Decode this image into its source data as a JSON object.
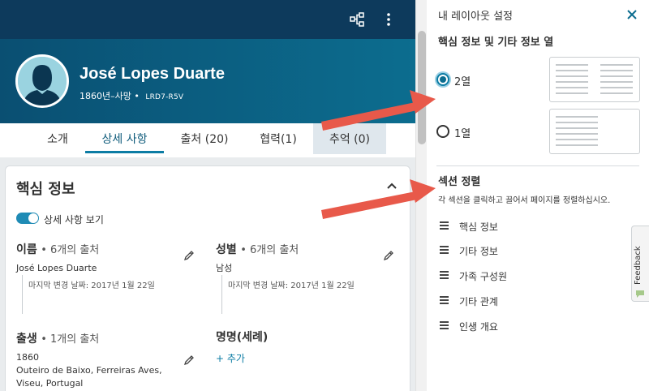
{
  "person": {
    "name": "José Lopes Duarte",
    "lifespan": "1860년–사망",
    "separator": "•",
    "id": "LRD7-R5V"
  },
  "tabs": [
    {
      "label": "소개"
    },
    {
      "label": "상세 사항",
      "active": true
    },
    {
      "label": "출처 (20)"
    },
    {
      "label": "협력(1)"
    },
    {
      "label": "추억 (0)"
    }
  ],
  "card": {
    "title": "핵심 정보",
    "toggle_label": "상세 사항 보기",
    "toggle_on": true,
    "fields": {
      "name": {
        "label": "이름",
        "sources": "• 6개의 출처",
        "value": "José Lopes Duarte",
        "changed": "마지막 변경 날짜: 2017년 1월 22일"
      },
      "sex": {
        "label": "성별",
        "sources": "• 6개의 출처",
        "value": "남성",
        "changed": "마지막 변경 날짜: 2017년 1월 22일"
      },
      "birth": {
        "label": "출생",
        "sources": "• 1개의 출처",
        "value_line1": "1860",
        "value_line2": "Outeiro de Baixo, Ferreiras Aves,",
        "value_line3": "Viseu, Portugal"
      },
      "christening": {
        "label": "명명(세례)",
        "add_label": "+ 추가"
      }
    }
  },
  "panel": {
    "title": "내 레이아웃 설정",
    "columns_heading": "핵심 정보 및 기타 정보 열",
    "option_two": "2열",
    "option_one": "1열",
    "selected_option": "2열",
    "sort_heading": "섹션 정렬",
    "sort_description": "각 섹션을 클릭하고 끌어서 페이지를 정렬하십시오.",
    "sections": [
      "핵심 정보",
      "기타 정보",
      "가족 구성원",
      "기타 관계",
      "인생 개요"
    ]
  },
  "feedback_label": "Feedback",
  "colors": {
    "topbar": "#0d3a5c",
    "accent": "#0c7ca4",
    "arrow": "#e8594a"
  },
  "icons": [
    "tree-icon",
    "more-vertical-icon",
    "chevron-up-icon",
    "pencil-icon",
    "close-icon",
    "drag-handle-icon",
    "feedback-icon"
  ]
}
